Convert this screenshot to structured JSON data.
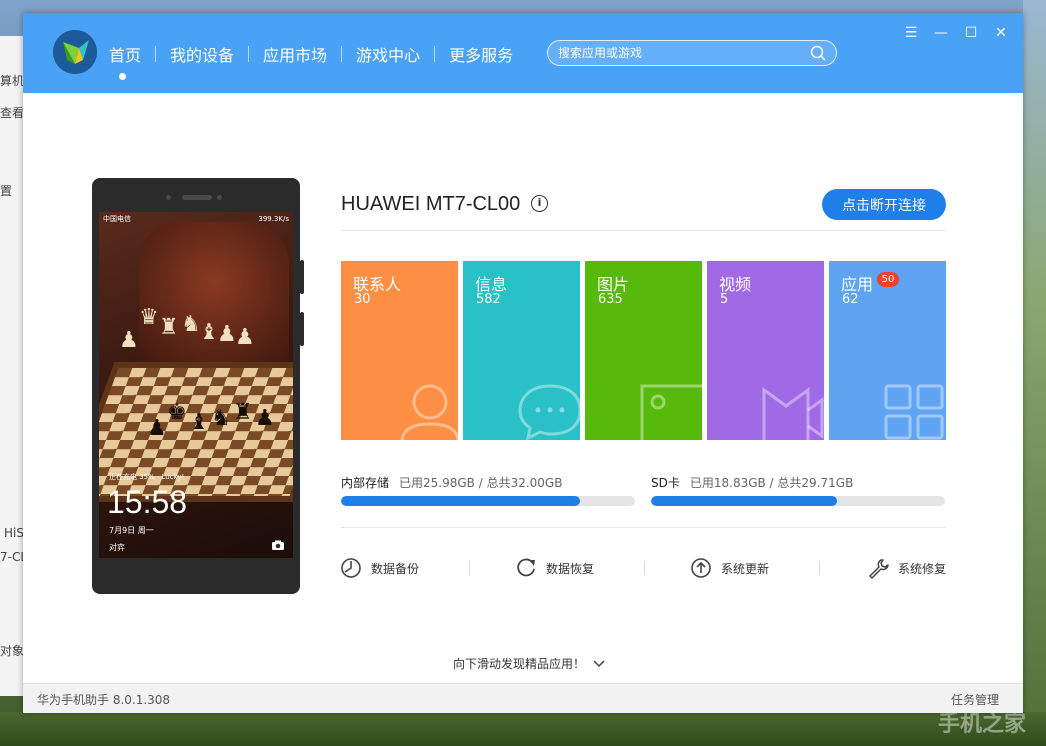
{
  "background": {
    "left_texts": [
      "算机",
      "查看(",
      "置",
      "HiS",
      "7-CL",
      "对象"
    ],
    "watermark": "手机之家"
  },
  "app": {
    "nav": [
      "首页",
      "我的设备",
      "应用市场",
      "游戏中心",
      "更多服务"
    ],
    "search_placeholder": "搜索应用或游戏",
    "window_controls": {
      "menu": "☰",
      "minimize": "—",
      "maximize": "☐",
      "close": "✕"
    }
  },
  "phone_screen": {
    "carrier": "中国电信",
    "net_speed": "399.3K/s",
    "charging_text": "正在充电 35% · Lucky!",
    "time": "15:58",
    "date": "7月9日 周一",
    "bottom_left": "对弈"
  },
  "device": {
    "name": "HUAWEI MT7-CL00",
    "disconnect_label": "点击断开连接"
  },
  "tiles": [
    {
      "label": "联系人",
      "count": "30",
      "color": "#fd8f45",
      "icon": "person-icon"
    },
    {
      "label": "信息",
      "count": "582",
      "color": "#29c1c6",
      "icon": "chat-bubble-icon"
    },
    {
      "label": "图片",
      "count": "635",
      "color": "#58b90d",
      "icon": "picture-icon"
    },
    {
      "label": "视频",
      "count": "5",
      "color": "#a06ae6",
      "icon": "video-camera-icon"
    },
    {
      "label": "应用",
      "count": "62",
      "badge": "50",
      "color": "#5fa4f0",
      "icon": "app-grid-icon"
    }
  ],
  "storage": {
    "internal": {
      "label": "内部存储",
      "used_text": "已用25.98GB / 总共32.00GB",
      "used_fraction": 0.812
    },
    "sd": {
      "label": "SD卡",
      "used_text": "已用18.83GB / 总共29.71GB",
      "used_fraction": 0.634
    }
  },
  "tools": [
    {
      "label": "数据备份",
      "icon": "backup-icon"
    },
    {
      "label": "数据恢复",
      "icon": "restore-icon"
    },
    {
      "label": "系统更新",
      "icon": "update-icon"
    },
    {
      "label": "系统修复",
      "icon": "wrench-icon"
    }
  ],
  "scroll_hint": "向下滑动发现精品应用！",
  "footer": {
    "version": "华为手机助手 8.0.1.308",
    "task_manager": "任务管理"
  },
  "colors": {
    "topbar": "#4aa2f7",
    "accent": "#1f7fe8"
  }
}
